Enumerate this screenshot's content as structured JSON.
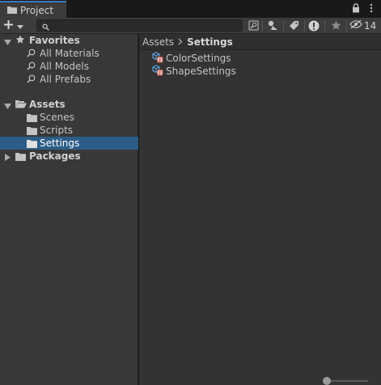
{
  "window": {
    "tab_title": "Project",
    "hidden_count": "14"
  },
  "toolbar": {
    "add_label": "+",
    "search": {
      "value": "",
      "placeholder": ""
    },
    "icons": [
      "search-by-type-icon",
      "label-icon",
      "warning-icon",
      "star-icon",
      "visibility-icon"
    ]
  },
  "sidebar": {
    "favorites": {
      "label": "Favorites",
      "items": [
        "All Materials",
        "All Models",
        "All Prefabs"
      ]
    },
    "assets": {
      "label": "Assets",
      "children": [
        "Scenes",
        "Scripts",
        "Settings"
      ],
      "selected": "Settings"
    },
    "packages": {
      "label": "Packages"
    }
  },
  "breadcrumb": {
    "root": "Assets",
    "current": "Settings"
  },
  "files": [
    {
      "name": "ColorSettings",
      "icon": "scriptable-object-icon"
    },
    {
      "name": "ShapeSettings",
      "icon": "scriptable-object-icon"
    }
  ],
  "zoom": {
    "value": 0
  },
  "colors": {
    "accent": "#3a79bb",
    "selection": "#2c5d87"
  }
}
